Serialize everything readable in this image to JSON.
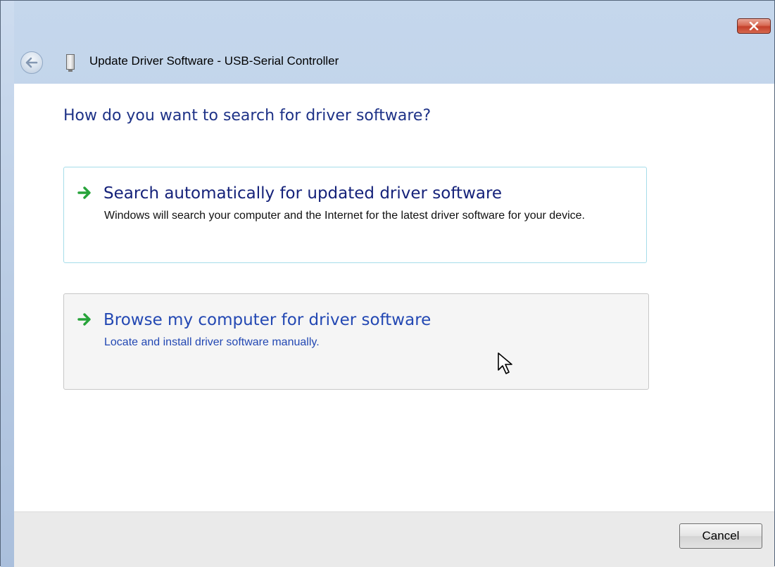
{
  "window": {
    "title": "Update Driver Software - USB-Serial Controller",
    "close_icon": "close-icon",
    "back_icon": "back-arrow-icon",
    "device_icon": "usb-device-icon"
  },
  "main": {
    "heading": "How do you want to search for driver software?",
    "options": [
      {
        "title": "Search automatically for updated driver software",
        "description": "Windows will search your computer and the Internet for the latest driver software for your device.",
        "icon": "green-arrow-icon"
      },
      {
        "title": "Browse my computer for driver software",
        "description": "Locate and install driver software manually.",
        "icon": "green-arrow-icon",
        "state": "hover"
      }
    ]
  },
  "footer": {
    "cancel_label": "Cancel"
  },
  "colors": {
    "heading": "#1e3287",
    "link_hover": "#2348b3",
    "close_button": "#c4402b",
    "arrow": "#27a33a"
  }
}
